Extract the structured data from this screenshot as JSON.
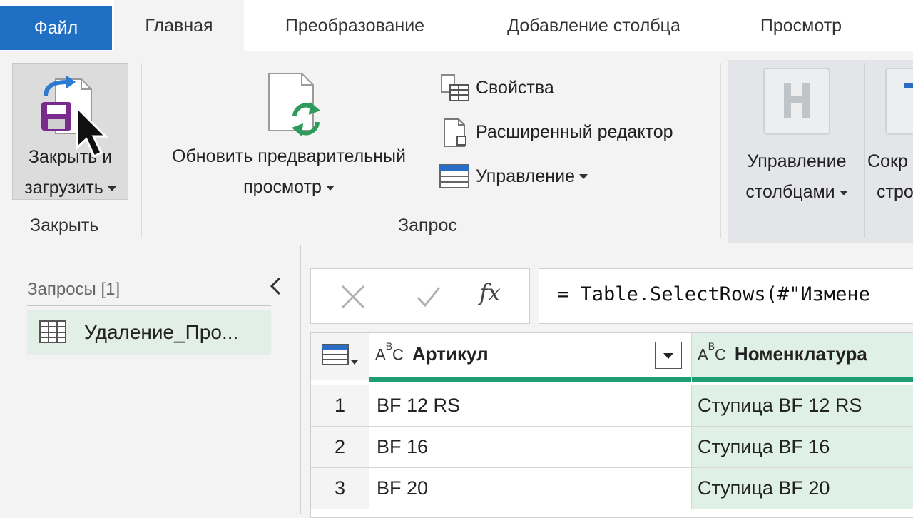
{
  "tabs": {
    "file": "Файл",
    "home": "Главная",
    "transform": "Преобразование",
    "add_column": "Добавление столбца",
    "view": "Просмотр"
  },
  "ribbon": {
    "close_load": {
      "line1": "Закрыть и",
      "line2": "загрузить"
    },
    "close_group_label": "Закрыть",
    "refresh_preview": {
      "line1": "Обновить предварительный",
      "line2": "просмотр"
    },
    "properties": "Свойства",
    "advanced_editor": "Расширенный редактор",
    "manage": "Управление",
    "query_group_label": "Запрос",
    "manage_columns": {
      "line1": "Управление",
      "line2": "столбцами"
    },
    "keep_rows": {
      "line1": "Сокр",
      "line2": "стро"
    }
  },
  "queries_pane": {
    "title": "Запросы [1]",
    "items": [
      {
        "label": "Удаление_Про..."
      }
    ]
  },
  "formula_bar": {
    "fx": "fx",
    "formula": "= Table.SelectRows(#\"Измене"
  },
  "table": {
    "columns": [
      {
        "type": "ABC",
        "name": "Артикул"
      },
      {
        "type": "ABC",
        "name": "Номенклатура"
      }
    ],
    "rows": [
      {
        "n": "1",
        "article": "BF 12 RS",
        "name": "Ступица BF 12 RS"
      },
      {
        "n": "2",
        "article": "BF 16",
        "name": "Ступица BF 16"
      },
      {
        "n": "3",
        "article": "BF 20",
        "name": "Ступица BF 20"
      }
    ]
  },
  "colors": {
    "file_tab": "#1f6fc5",
    "accent_green": "#1f9d74",
    "selected_column": "#dff0e6"
  }
}
